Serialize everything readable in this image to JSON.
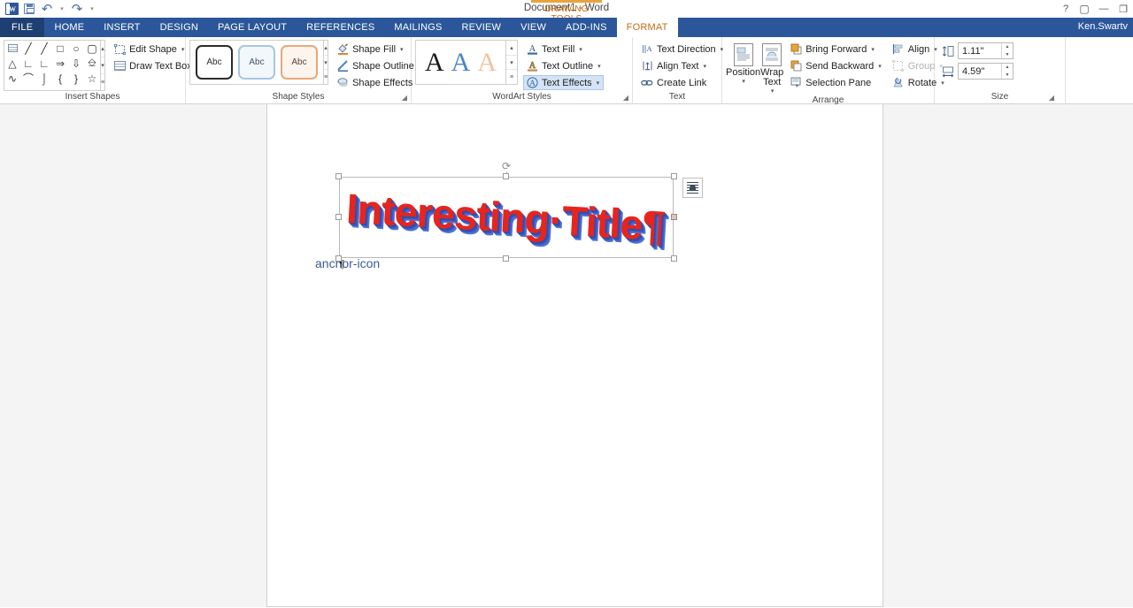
{
  "titlebar": {
    "document_title": "Document1 - Word",
    "contextual_tab_label": "DRAWING TOOLS",
    "quick_access": [
      {
        "name": "word-logo-icon",
        "label": "W"
      },
      {
        "name": "save-icon",
        "label": "Save"
      },
      {
        "name": "undo-icon",
        "label": "↶"
      },
      {
        "name": "redo-icon",
        "label": "↻"
      },
      {
        "name": "customize-qat-icon",
        "label": "▾"
      }
    ],
    "window_controls": {
      "help": "?",
      "ribbon_display_options": "⧉",
      "minimize": "—",
      "restore": "❐"
    }
  },
  "tabs": {
    "file": "FILE",
    "items": [
      {
        "label": "HOME",
        "active": false
      },
      {
        "label": "INSERT",
        "active": false
      },
      {
        "label": "DESIGN",
        "active": false
      },
      {
        "label": "PAGE LAYOUT",
        "active": false
      },
      {
        "label": "REFERENCES",
        "active": false
      },
      {
        "label": "MAILINGS",
        "active": false
      },
      {
        "label": "REVIEW",
        "active": false
      },
      {
        "label": "VIEW",
        "active": false
      },
      {
        "label": "ADD-INS",
        "active": false
      },
      {
        "label": "FORMAT",
        "active": true
      }
    ],
    "user_name": "Ken.Swartv"
  },
  "ribbon": {
    "insert_shapes": {
      "label": "Insert Shapes",
      "gallery_shapes": [
        "textbox",
        "line",
        "line-arrow",
        "rectangle",
        "oval",
        "rounded-rectangle",
        "triangle",
        "elbow-connector",
        "elbow-arrow-connector",
        "right-arrow",
        "down-arrow",
        "flowchart-shape",
        "scribble",
        "arc",
        "curve",
        "left-brace",
        "right-brace",
        "star"
      ],
      "scroll_buttons": [
        "▴",
        "▾",
        "≡"
      ],
      "menu": [
        {
          "label": "Edit Shape",
          "icon": "edit-shape-icon",
          "has_caret": true
        },
        {
          "label": "Draw Text Box",
          "icon": "draw-text-box-icon",
          "has_caret": false
        }
      ]
    },
    "shape_styles": {
      "label": "Shape Styles",
      "thumbnails": [
        "Abc",
        "Abc",
        "Abc"
      ],
      "scroll_buttons": [
        "▴",
        "▾",
        "≡"
      ],
      "menu": [
        {
          "label": "Shape Fill",
          "icon": "shape-fill-icon",
          "has_caret": true
        },
        {
          "label": "Shape Outline",
          "icon": "shape-outline-icon",
          "has_caret": true
        },
        {
          "label": "Shape Effects",
          "icon": "shape-effects-icon",
          "has_caret": true
        }
      ],
      "dialog_launcher": "◢"
    },
    "wordart_styles": {
      "label": "WordArt Styles",
      "thumbnails": [
        "A",
        "A",
        "A"
      ],
      "scroll_buttons": [
        "▴",
        "▾",
        "≡"
      ],
      "menu": [
        {
          "label": "Text Fill",
          "icon": "text-fill-icon",
          "has_caret": true,
          "hovered": false
        },
        {
          "label": "Text Outline",
          "icon": "text-outline-icon",
          "has_caret": true,
          "hovered": false
        },
        {
          "label": "Text Effects",
          "icon": "text-effects-icon",
          "has_caret": true,
          "hovered": true
        }
      ],
      "dialog_launcher": "◢"
    },
    "text": {
      "label": "Text",
      "menu": [
        {
          "label": "Text Direction",
          "icon": "text-direction-icon",
          "has_caret": true
        },
        {
          "label": "Align Text",
          "icon": "align-text-icon",
          "has_caret": true
        },
        {
          "label": "Create Link",
          "icon": "create-link-icon",
          "has_caret": false
        }
      ]
    },
    "arrange": {
      "label": "Arrange",
      "big_buttons": [
        {
          "label": "Position",
          "icon": "position-icon",
          "has_caret": true
        },
        {
          "label": "Wrap Text",
          "icon": "wrap-text-icon",
          "has_caret": true
        }
      ],
      "menu_col1": [
        {
          "label": "Bring Forward",
          "icon": "bring-forward-icon",
          "has_caret": true,
          "disabled": false
        },
        {
          "label": "Send Backward",
          "icon": "send-backward-icon",
          "has_caret": true,
          "disabled": false
        },
        {
          "label": "Selection Pane",
          "icon": "selection-pane-icon",
          "has_caret": false,
          "disabled": false
        }
      ],
      "menu_col2": [
        {
          "label": "Align",
          "icon": "align-icon",
          "has_caret": true,
          "disabled": false
        },
        {
          "label": "Group",
          "icon": "group-icon",
          "has_caret": true,
          "disabled": true
        },
        {
          "label": "Rotate",
          "icon": "rotate-icon",
          "has_caret": true,
          "disabled": false
        }
      ]
    },
    "size": {
      "label": "Size",
      "height": {
        "icon": "shape-height-icon",
        "value": "1.11\"",
        "placeholder": "0\""
      },
      "width": {
        "icon": "shape-width-icon",
        "value": "4.59\"",
        "placeholder": "0\""
      },
      "dialog_launcher": "◢"
    }
  },
  "document": {
    "wordart": {
      "text": "Interesting·Title¶",
      "fill_color": "#e8241c",
      "shadow_color": "#2f4fb0"
    },
    "layout_options_icon": "layout-options-icon",
    "anchor_icon": "anchor-icon",
    "paragraph_mark": "¶",
    "handles": [
      "nw",
      "n",
      "ne",
      "w",
      "e",
      "sw",
      "s",
      "se"
    ],
    "rotate_handle_icon": "rotate-handle-icon"
  }
}
